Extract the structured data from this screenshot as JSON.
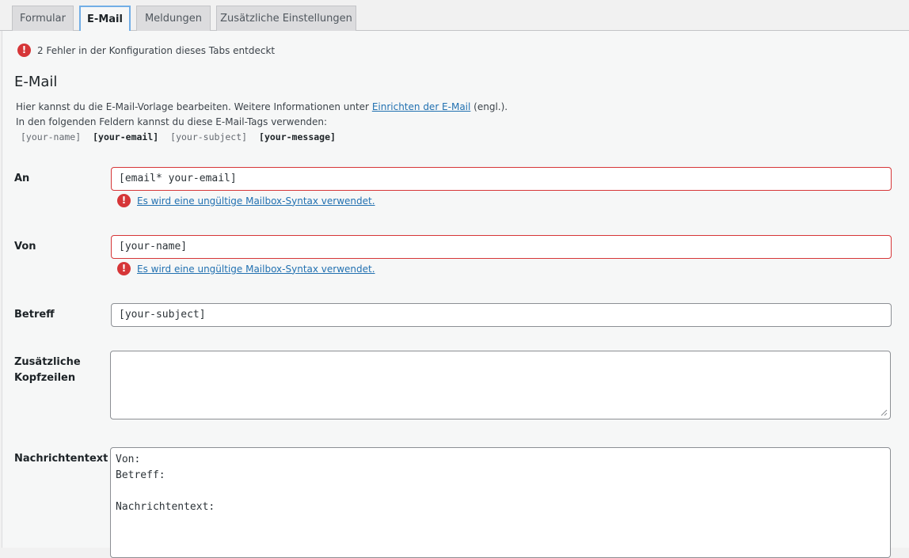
{
  "tabs": [
    {
      "label": "Formular"
    },
    {
      "label": "E-Mail"
    },
    {
      "label": "Meldungen"
    },
    {
      "label": "Zusätzliche Einstellungen"
    }
  ],
  "error_summary": {
    "icon": "exclamation-icon",
    "text": "2 Fehler in der Konfiguration dieses Tabs entdeckt"
  },
  "section": {
    "title": "E-Mail",
    "desc_prefix": "Hier kannst du die E-Mail-Vorlage bearbeiten. Weitere Informationen unter ",
    "desc_link": "Einrichten der E-Mail",
    "desc_suffix": " (engl.).",
    "desc_line2": "In den folgenden Feldern kannst du diese E-Mail-Tags verwenden:",
    "tags": [
      "[your-name]",
      "[your-email]",
      "[your-subject]",
      "[your-message]"
    ]
  },
  "fields": {
    "to": {
      "label": "An",
      "value": "[email* your-email]",
      "error": "Es wird eine ungültige Mailbox-Syntax verwendet."
    },
    "from": {
      "label": "Von",
      "value": "[your-name]",
      "error": "Es wird eine ungültige Mailbox-Syntax verwendet."
    },
    "subject": {
      "label": "Betreff",
      "value": "[your-subject]"
    },
    "headers": {
      "label": "Zusätzliche Kopfzeilen",
      "label_line1": "Zusätzliche",
      "label_line2": "Kopfzeilen",
      "value": ""
    },
    "body": {
      "label": "Nachrichtentext",
      "value": "Von:\nBetreff:\n\nNachrichtentext:"
    }
  },
  "colors": {
    "error": "#d63638",
    "link": "#2271b1",
    "active_tab_border": "#72aee6"
  }
}
